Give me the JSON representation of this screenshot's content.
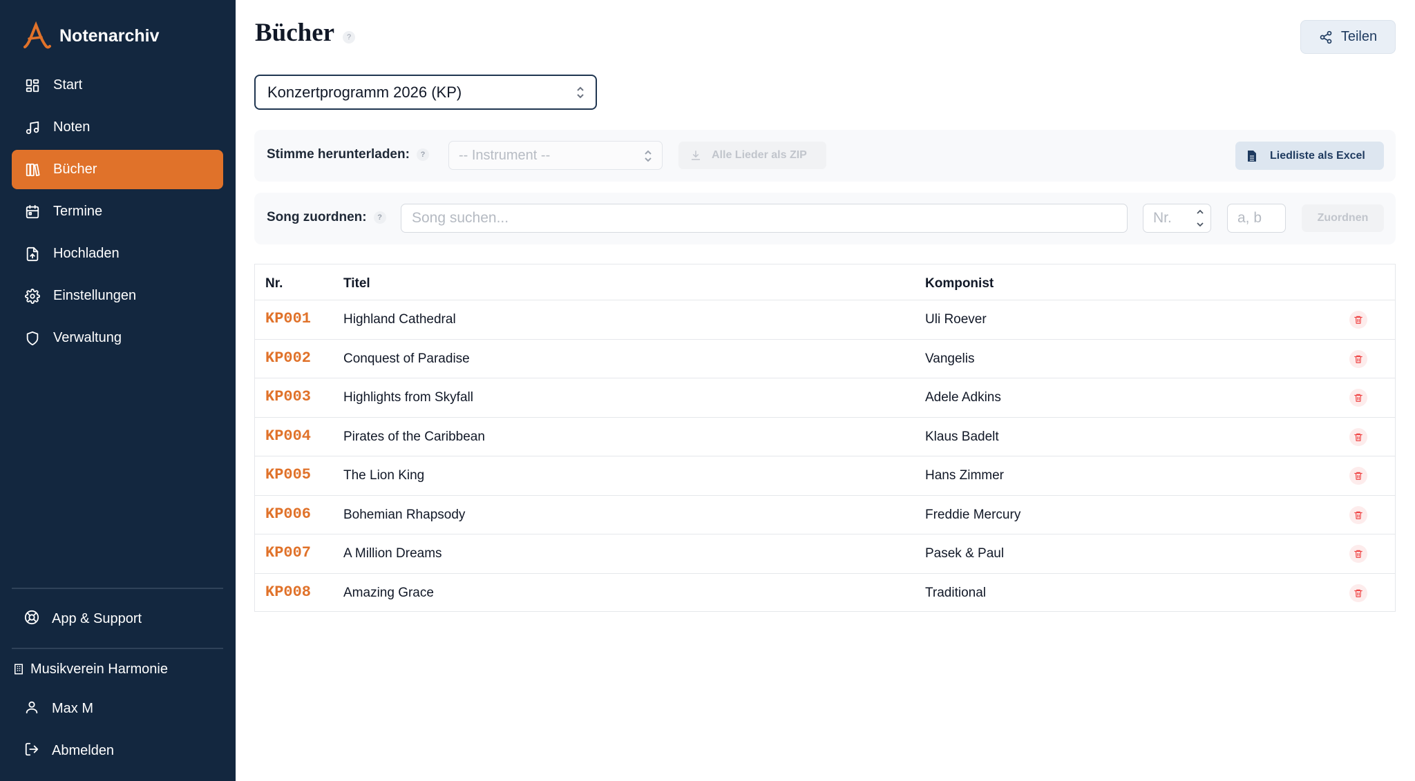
{
  "app": {
    "name": "Notenarchiv",
    "accent": "#e0722a",
    "sidebar_bg": "#13273f"
  },
  "nav": {
    "items": [
      {
        "label": "Start",
        "icon": "dashboard-icon"
      },
      {
        "label": "Noten",
        "icon": "music-note-icon"
      },
      {
        "label": "Bücher",
        "icon": "library-icon",
        "active": true
      },
      {
        "label": "Termine",
        "icon": "calendar-icon"
      },
      {
        "label": "Hochladen",
        "icon": "upload-file-icon"
      },
      {
        "label": "Einstellungen",
        "icon": "gear-icon"
      },
      {
        "label": "Verwaltung",
        "icon": "shield-icon"
      }
    ],
    "support": "App & Support",
    "organization": "Musikverein Harmonie",
    "user": "Max M",
    "logout": "Abmelden"
  },
  "page": {
    "title": "Bücher",
    "help": "?",
    "share_label": "Teilen",
    "book_selected": "Konzertprogramm 2026 (KP)"
  },
  "download": {
    "label": "Stimme herunterladen:",
    "instrument_placeholder": "-- Instrument --",
    "zip_label": "Alle Lieder als ZIP",
    "excel_label": "Liedliste als Excel"
  },
  "assign": {
    "label": "Song zuordnen:",
    "search_placeholder": "Song suchen...",
    "nr_placeholder": "Nr.",
    "suffix_placeholder": "a, b",
    "button_label": "Zuordnen"
  },
  "table": {
    "headers": {
      "nr": "Nr.",
      "title": "Titel",
      "composer": "Komponist"
    },
    "rows": [
      {
        "nr": "KP001",
        "title": "Highland Cathedral",
        "composer": "Uli Roever"
      },
      {
        "nr": "KP002",
        "title": "Conquest of Paradise",
        "composer": "Vangelis"
      },
      {
        "nr": "KP003",
        "title": "Highlights from Skyfall",
        "composer": "Adele Adkins"
      },
      {
        "nr": "KP004",
        "title": "Pirates of the Caribbean",
        "composer": "Klaus Badelt"
      },
      {
        "nr": "KP005",
        "title": "The Lion King",
        "composer": "Hans Zimmer"
      },
      {
        "nr": "KP006",
        "title": "Bohemian Rhapsody",
        "composer": "Freddie Mercury"
      },
      {
        "nr": "KP007",
        "title": "A Million Dreams",
        "composer": "Pasek & Paul"
      },
      {
        "nr": "KP008",
        "title": "Amazing Grace",
        "composer": "Traditional"
      }
    ]
  }
}
